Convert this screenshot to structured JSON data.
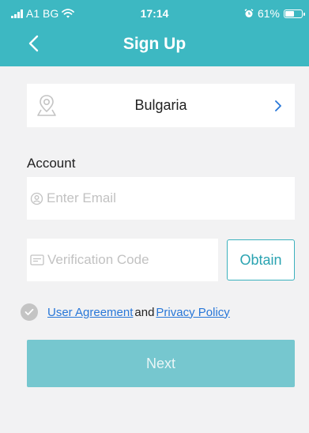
{
  "status_bar": {
    "carrier": "A1 BG",
    "time": "17:14",
    "battery": "61%",
    "battery_level": 0.61
  },
  "header": {
    "title": "Sign Up",
    "background": "#3db8c2",
    "back_icon": "chevron-left-icon"
  },
  "country": {
    "name": "Bulgaria",
    "icon": "location-pin-icon",
    "chevron_icon": "chevron-right-icon"
  },
  "account": {
    "label": "Account",
    "email_placeholder": "Enter Email",
    "email_icon": "user-icon",
    "email_value": ""
  },
  "verification": {
    "placeholder": "Verification Code",
    "icon": "message-icon",
    "value": "",
    "obtain_label": "Obtain"
  },
  "agreement": {
    "user_agreement": "User Agreement",
    "and": "and",
    "privacy_policy": "Privacy Policy",
    "checked": false
  },
  "next_button": {
    "label": "Next",
    "background": "#76c7cf"
  },
  "colors": {
    "accent": "#3db8c2",
    "link": "#2877d8",
    "page_background": "#f2f2f3"
  }
}
